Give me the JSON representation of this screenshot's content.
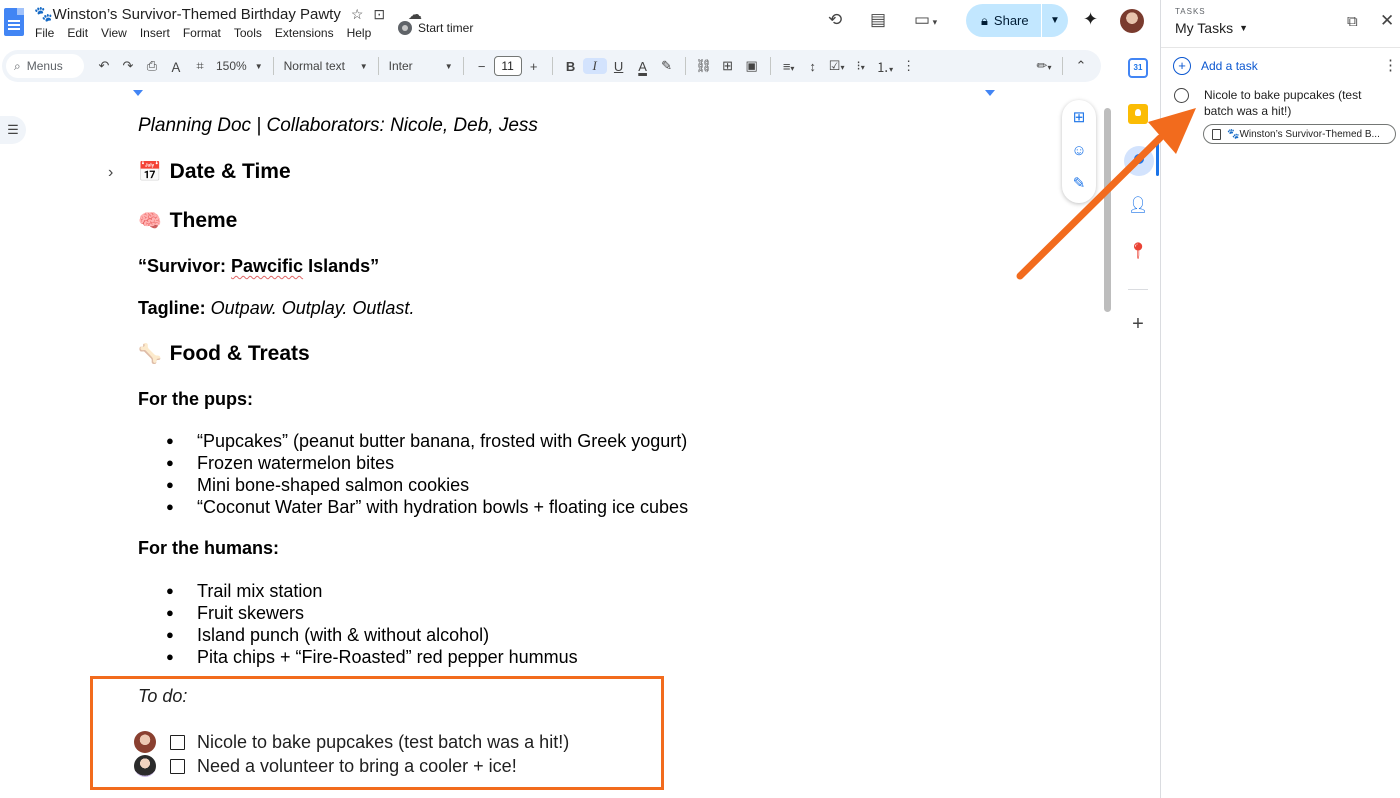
{
  "app": {
    "doc_title": "🐾Winston’s Survivor-Themed Birthday Pawty",
    "menu": [
      "File",
      "Edit",
      "View",
      "Insert",
      "Format",
      "Tools",
      "Extensions",
      "Help"
    ],
    "timer_label": "Start timer",
    "share_label": "Share"
  },
  "toolbar": {
    "search_label": "Menus",
    "zoom": "150%",
    "style": "Normal text",
    "font": "Inter",
    "font_size": "11"
  },
  "document": {
    "collaborators_line": "Planning Doc | Collaborators: Nicole, Deb, Jess",
    "headings": {
      "date_time": {
        "emoji": "📅",
        "text": "Date & Time"
      },
      "theme": {
        "emoji": "🧠",
        "text": "Theme"
      },
      "food": {
        "emoji": "🦴",
        "text": "Food & Treats"
      }
    },
    "theme_title_pre": "“Survivor: ",
    "theme_title_squiggle": "Pawcific",
    "theme_title_post": " Islands”",
    "tagline_label": "Tagline:",
    "tagline_text": " Outpaw. Outplay. Outlast.",
    "pups_heading": "For the pups:",
    "pups_items": [
      "“Pupcakes” (peanut butter banana, frosted with Greek yogurt)",
      "Frozen watermelon bites",
      "Mini bone-shaped salmon cookies",
      "“Coconut Water Bar” with hydration bowls + floating ice cubes"
    ],
    "humans_heading": "For the humans:",
    "humans_items": [
      "Trail mix station",
      "Fruit skewers",
      "Island punch (with & without alcohol)",
      "Pita chips + “Fire-Roasted” red pepper hummus"
    ],
    "todo_label": "To do:",
    "todo_items": [
      "Nicole to bake pupcakes (test batch was a hit!)",
      "Need a volunteer to bring a cooler + ice!"
    ]
  },
  "tasks_panel": {
    "kicker": "TASKS",
    "list_name": "My Tasks",
    "add_label": "Add a task",
    "task_title": "Nicole to bake pupcakes (test batch was a hit!)",
    "task_chip": "🐾Winston’s Survivor-Themed B..."
  },
  "colors": {
    "accent": "#1a73e8",
    "share_bg": "#c2e7ff",
    "highlight_orange": "#f26b1d"
  }
}
